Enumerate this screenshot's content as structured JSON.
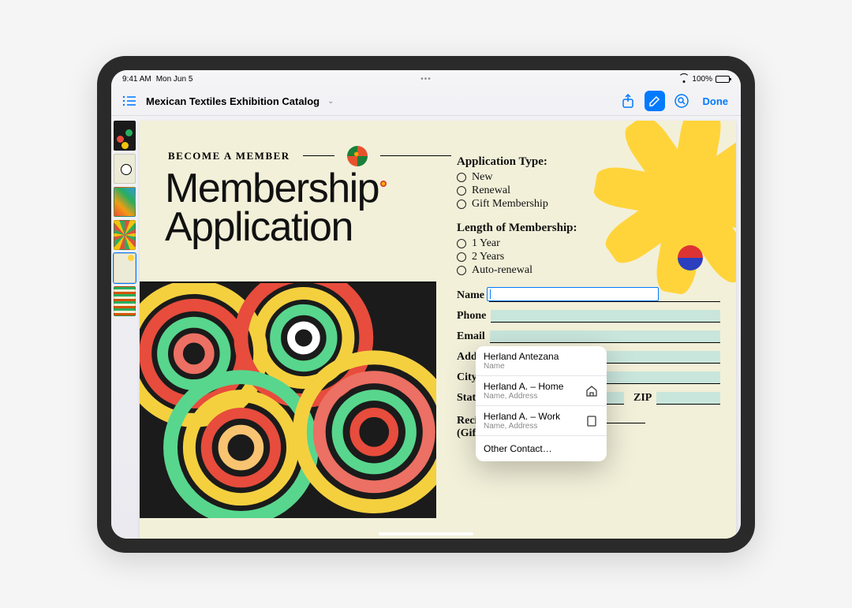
{
  "statusbar": {
    "time": "9:41 AM",
    "date": "Mon Jun 5",
    "battery_pct": "100%"
  },
  "toolbar": {
    "doc_title": "Mexican Textiles Exhibition Catalog",
    "done_label": "Done"
  },
  "page": {
    "become_label": "BECOME A MEMBER",
    "big_title_line1": "Membership",
    "big_title_line2": "Application",
    "app_type_heading": "Application Type:",
    "app_type_options": [
      "New",
      "Renewal",
      "Gift Membership"
    ],
    "length_heading": "Length of Membership:",
    "length_options": [
      "1 Year",
      "2 Years",
      "Auto-renewal"
    ],
    "fields": {
      "name": "Name",
      "phone": "Phone",
      "email": "Email",
      "address": "Address",
      "city": "City",
      "state": "State",
      "zip": "ZIP"
    },
    "gift_label_line1": "Recipient's Name",
    "gift_label_line2": "(Gift Membership)"
  },
  "popover": {
    "items": [
      {
        "title": "Herland Antezana",
        "sub": "Name",
        "icon": ""
      },
      {
        "title": "Herland A. – Home",
        "sub": "Name, Address",
        "icon": "home"
      },
      {
        "title": "Herland A. – Work",
        "sub": "Name, Address",
        "icon": "building"
      }
    ],
    "other_label": "Other Contact…"
  }
}
